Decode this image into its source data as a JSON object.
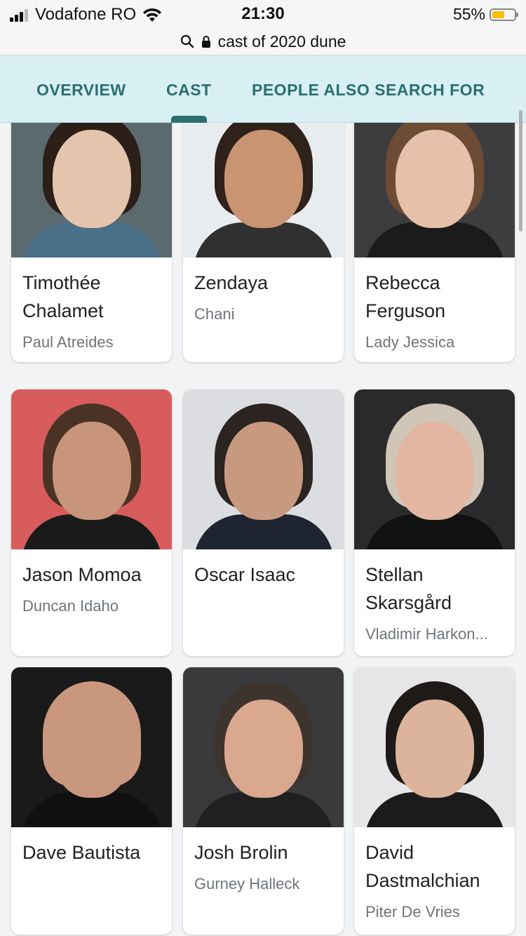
{
  "status_bar": {
    "carrier": "Vodafone RO",
    "time": "21:30",
    "battery_percent": "55%",
    "battery_level": 0.55
  },
  "url_bar": {
    "query": "cast of 2020 dune"
  },
  "tabs": [
    {
      "label": "OVERVIEW",
      "active": false
    },
    {
      "label": "CAST",
      "active": true
    },
    {
      "label": "PEOPLE ALSO SEARCH FOR",
      "active": false
    }
  ],
  "cast": [
    {
      "name": "Timothée Chalamet",
      "role": "Paul Atreides",
      "bg": "#5b6a6f",
      "skin": "#e5c4ad",
      "hair": "#2b1f17",
      "clothes": "#4a6f88"
    },
    {
      "name": "Zendaya",
      "role": "Chani",
      "bg": "#e9ecef",
      "skin": "#c99471",
      "hair": "#2f221b",
      "clothes": "#303030"
    },
    {
      "name": "Rebecca Ferguson",
      "role": "Lady Jessica",
      "bg": "#3d3d40",
      "skin": "#e6c0a8",
      "hair": "#6e4b34",
      "clothes": "#1b1b1b"
    },
    {
      "name": "Jason Momoa",
      "role": "Duncan Idaho",
      "bg": "#d95c5c",
      "skin": "#c8957a",
      "hair": "#4a3325",
      "clothes": "#1a1a1a"
    },
    {
      "name": "Oscar Isaac",
      "role": "",
      "bg": "#dcdde0",
      "skin": "#c79a80",
      "hair": "#2b2420",
      "clothes": "#1f2530"
    },
    {
      "name": "Stellan Skarsgård",
      "role": "Vladimir Harkon...",
      "bg": "#2a2a2c",
      "skin": "#e2b6a0",
      "hair": "#cfc6b8",
      "clothes": "#111111"
    },
    {
      "name": "Dave Bautista",
      "role": "",
      "bg": "#1a1a1a",
      "skin": "#c9977d",
      "hair": "#c9977d",
      "clothes": "#101010"
    },
    {
      "name": "Josh Brolin",
      "role": "Gurney Halleck",
      "bg": "#3a3a3c",
      "skin": "#d9a88e",
      "hair": "#3d342d",
      "clothes": "#202020"
    },
    {
      "name": "David Dastmalchian",
      "role": "Piter De Vries",
      "bg": "#e6e6e8",
      "skin": "#dcb39b",
      "hair": "#1d1a18",
      "clothes": "#1b1b1b"
    }
  ]
}
